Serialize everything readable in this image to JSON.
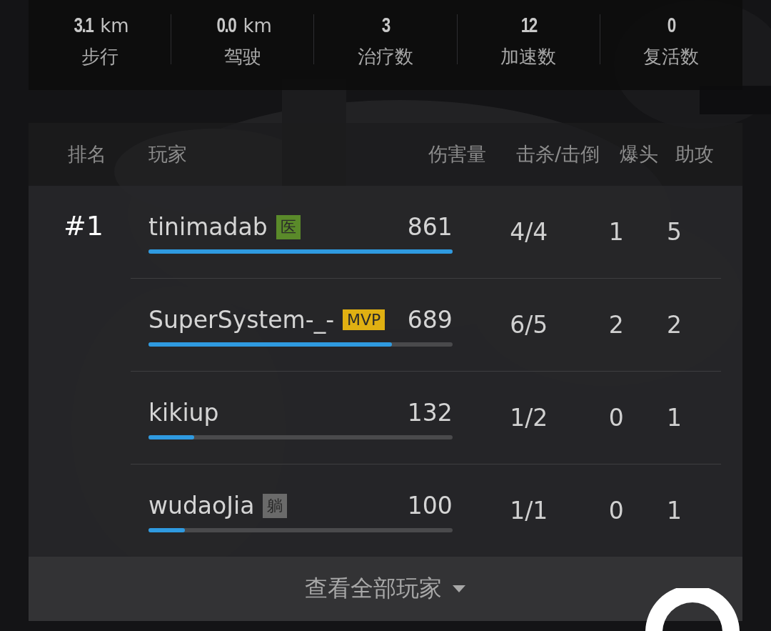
{
  "stats": [
    {
      "value": "3.1",
      "unit": "km",
      "label": "步行"
    },
    {
      "value": "0.0",
      "unit": "km",
      "label": "驾驶"
    },
    {
      "value": "3",
      "label": "治疗数"
    },
    {
      "value": "12",
      "label": "加速数"
    },
    {
      "value": "0",
      "label": "复活数"
    }
  ],
  "table": {
    "columns": [
      "排名",
      "玩家",
      "伤害量",
      "击杀/击倒",
      "爆头",
      "助攻"
    ],
    "rows": [
      {
        "rank": "#1",
        "player": "tinimadab",
        "tag": {
          "text": "医",
          "color": "#5a8a2a"
        },
        "damage": "861",
        "level": 1.0,
        "kills": "4/4",
        "headshots": "1",
        "assists": "5"
      },
      {
        "player": "SuperSystem-_-",
        "tag": {
          "text": "MVP",
          "color": "#e0b012"
        },
        "damage": "689",
        "level": 0.8,
        "kills": "6/5",
        "headshots": "2",
        "assists": "2"
      },
      {
        "player": "kikiup",
        "damage": "132",
        "level": 0.15,
        "kills": "1/2",
        "headshots": "0",
        "assists": "1"
      },
      {
        "player": "wudaoJia",
        "tag": {
          "text": "躺",
          "color": "#6a6a6a"
        },
        "damage": "100",
        "level": 0.12,
        "kills": "1/1",
        "headshots": "0",
        "assists": "1"
      }
    ]
  },
  "view_all_button": {
    "label": "查看全部玩家"
  }
}
